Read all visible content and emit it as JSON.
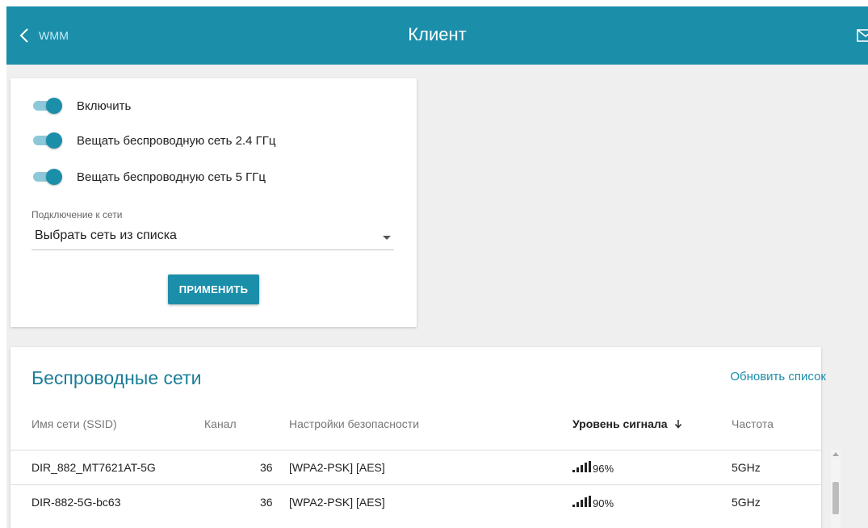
{
  "header": {
    "back_label": "WMM",
    "title": "Клиент"
  },
  "client_settings": {
    "toggles": [
      {
        "label": "Включить",
        "on": true
      },
      {
        "label": "Вещать беспроводную сеть 2.4 ГГц",
        "on": true
      },
      {
        "label": "Вещать беспроводную сеть 5 ГГц",
        "on": true
      }
    ],
    "network_label": "Подключение к сети",
    "network_value": "Выбрать сеть из списка",
    "apply_label": "ПРИМЕНИТЬ"
  },
  "wireless": {
    "title": "Беспроводные сети",
    "refresh_label": "Обновить список",
    "columns": [
      "Имя сети (SSID)",
      "Канал",
      "Настройки безопасности",
      "Уровень сигнала",
      "Частота"
    ],
    "rows": [
      {
        "ssid": "DIR_882_MT7621AT-5G",
        "channel": "36",
        "security": "[WPA2-PSK] [AES]",
        "signal": "96%",
        "frequency": "5GHz"
      },
      {
        "ssid": "DIR-882-5G-bc63",
        "channel": "36",
        "security": "[WPA2-PSK] [AES]",
        "signal": "90%",
        "frequency": "5GHz"
      }
    ]
  },
  "colors": {
    "accent": "#1b8eaa",
    "background": "#efefef"
  }
}
